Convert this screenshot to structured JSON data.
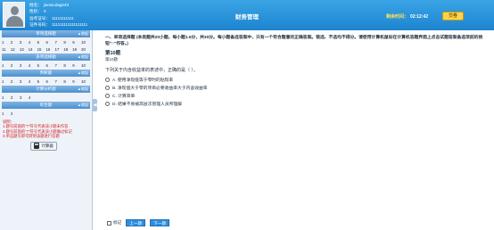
{
  "header": {
    "title": "财务管理",
    "student": [
      {
        "label": "姓名：",
        "value": "jiaowudage40"
      },
      {
        "label": "性别：",
        "value": "X"
      },
      {
        "label": "准考证号：",
        "value": "11111111111"
      },
      {
        "label": "证件号码：",
        "value": "111111111111111111"
      }
    ],
    "timer_label": "剩余时间：",
    "timer_value": "02:12:42",
    "submit_label": "交卷"
  },
  "sidebar": {
    "sections": [
      {
        "title": "单项选择题",
        "collapse": "▲收起",
        "rows": [
          [
            "1",
            "2",
            "3",
            "4",
            "5",
            "6",
            "7",
            "8",
            "9",
            "10"
          ],
          [
            "11",
            "12",
            "13",
            "14",
            "15",
            "16",
            "17",
            "18",
            "19",
            "20"
          ]
        ]
      },
      {
        "title": "多项选择题",
        "collapse": "▲收起",
        "rows": [
          [
            "1",
            "2",
            "3",
            "4",
            "5",
            "6",
            "7",
            "8",
            "9",
            "10"
          ]
        ]
      },
      {
        "title": "判断题",
        "collapse": "▲收起",
        "rows": [
          [
            "1",
            "2",
            "3",
            "4",
            "5",
            "6",
            "7",
            "8",
            "9",
            "10"
          ]
        ]
      },
      {
        "title": "计算分析题",
        "collapse": "▲收起",
        "rows": [
          [
            "1",
            "2",
            "3",
            "4"
          ]
        ]
      },
      {
        "title": "综合题",
        "collapse": "▲收起",
        "rows": [
          [
            "1",
            "2"
          ]
        ]
      }
    ],
    "notes": [
      "说明：",
      "1.题号前面的\"?\"符号代表该小题未作答",
      "2.题号前面的\"?\"符号代表该小题做过标记",
      "3.单击题号即可转到该题进行答题"
    ],
    "calculator_label": "计算器",
    "toggle": "◀"
  },
  "question": {
    "instruction_bold": "一、单项选择题",
    "instruction": "(本类题共20小题，每小题1.5分，共30分。每小题备选答案中，只有一个符合题意的正确答案。错选、不选均不得分。请使用计算机鼠标在计算机答题界面上点击试题答案备选项前的按钮\"○\"作答。)",
    "number": "第10题",
    "sub": "第10题",
    "stem": "下列关于内含收益率的表述中，正确的是（  ）。",
    "options": [
      "A. 使用净现值等于零时的贴现率",
      "B. 净现值大于零的项目必要收益率大于内含收益率",
      "C. 计算简单",
      "D. 结果不易被高层次管理人员所理解"
    ],
    "mark_label": "标记",
    "prev_label": "上一题",
    "next_label": "下一题"
  }
}
